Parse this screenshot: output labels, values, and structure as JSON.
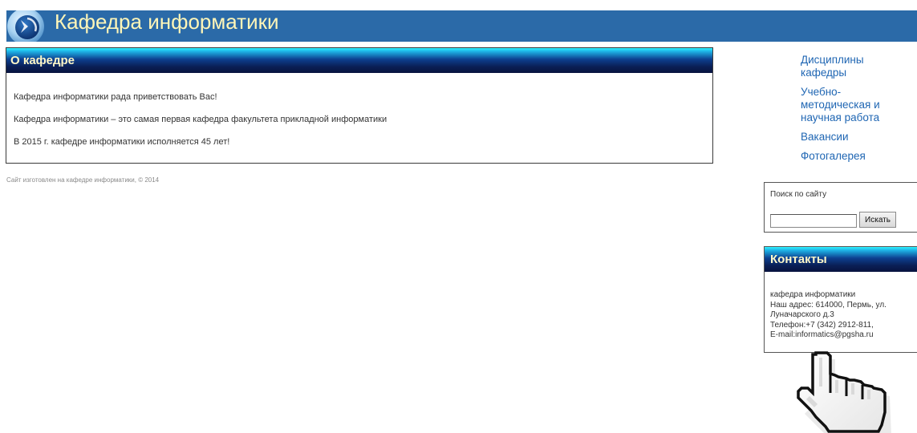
{
  "header": {
    "title": "Кафедра информатики",
    "background_color": "#2b6aa8",
    "title_color": "#fff6b8",
    "logo_icon": "department-logo-icon"
  },
  "main": {
    "panel_title": "О кафедре",
    "paragraphs": [
      "Кафедра информатики рада приветствовать Вас!",
      "Кафедра информатики – это самая первая кафедра факультета прикладной информатики",
      "В 2015 г. кафедре информатики исполняется 45 лет!"
    ]
  },
  "footer": {
    "text": "Сайт изготовлен на кафедре информатики, © 2014"
  },
  "nav": {
    "link_color": "#1f66b3",
    "items": [
      {
        "label": "Дисциплины кафедры"
      },
      {
        "label": "Учебно-методическая и научная работа"
      },
      {
        "label": "Вакансии"
      },
      {
        "label": "Фотогалерея"
      }
    ]
  },
  "search": {
    "label": "Поиск по сайту",
    "input_value": "",
    "button_label": "Искать"
  },
  "contacts": {
    "title": "Контакты",
    "lines": [
      "кафедра информатики",
      "Наш адрес: 614000, Пермь, ул.",
      "Луначарского д.3",
      "Телефон:+7 (342) 2912-811,",
      "E-mail:informatics@pgsha.ru"
    ]
  },
  "cursor": {
    "icon": "hand-pointer-cursor-icon"
  }
}
